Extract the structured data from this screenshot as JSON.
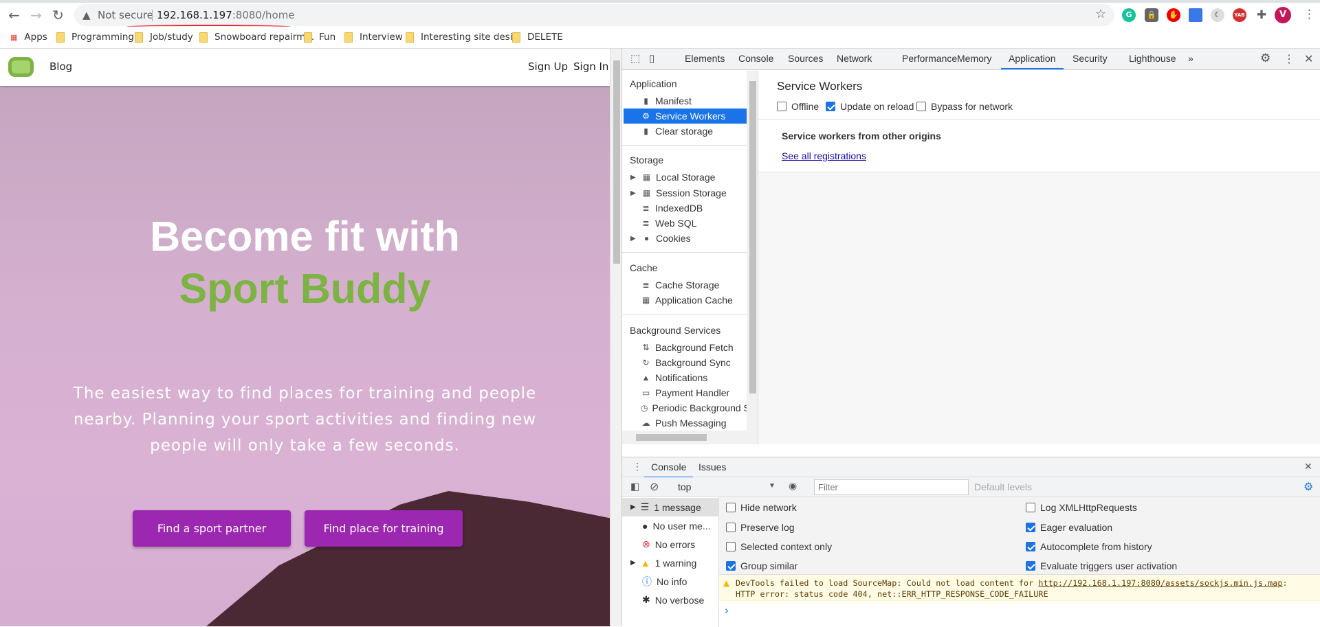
{
  "browser": {
    "security_label": "Not secure",
    "url_host": "192.168.1.197",
    "url_rest": ":8080/home",
    "profile_initial": "V",
    "extensions": [
      "grammarly",
      "lock",
      "adblock",
      "calendar",
      "dark-mode",
      "yab",
      "extensions-puzzle"
    ]
  },
  "bookmarks": [
    "Apps",
    "Programming",
    "Job/study",
    "Snowboard repairm...",
    "Fun",
    "Interview",
    "Interesting site desi...",
    "DELETE"
  ],
  "site": {
    "nav_blog": "Blog",
    "sign_up": "Sign Up",
    "sign_in": "Sign In",
    "headline_1": "Become fit with",
    "headline_2": "Sport Buddy",
    "subtitle": "The easiest way to find places for training and people nearby. Planning your sport activities and finding new people will only take a few seconds.",
    "btn_partner": "Find a sport partner",
    "btn_place": "Find place for training",
    "accent": "#7cb342",
    "button_color": "#9c27b0"
  },
  "devtools": {
    "tabs": [
      "Elements",
      "Console",
      "Sources",
      "Network",
      "Performance",
      "Memory",
      "Application",
      "Security",
      "Lighthouse"
    ],
    "active_tab": "Application",
    "sidebar": {
      "application": {
        "title": "Application",
        "items": [
          "Manifest",
          "Service Workers",
          "Clear storage"
        ]
      },
      "storage": {
        "title": "Storage",
        "items": [
          "Local Storage",
          "Session Storage",
          "IndexedDB",
          "Web SQL",
          "Cookies"
        ]
      },
      "cache": {
        "title": "Cache",
        "items": [
          "Cache Storage",
          "Application Cache"
        ]
      },
      "background": {
        "title": "Background Services",
        "items": [
          "Background Fetch",
          "Background Sync",
          "Notifications",
          "Payment Handler",
          "Periodic Background Sync",
          "Push Messaging"
        ]
      }
    },
    "panel": {
      "title": "Service Workers",
      "offline": "Offline",
      "update_on_reload": "Update on reload",
      "bypass": "Bypass for network",
      "other_origins": "Service workers from other origins",
      "see_all": "See all registrations"
    },
    "drawer": {
      "tabs": [
        "Console",
        "Issues"
      ],
      "context": "top",
      "filter_placeholder": "Filter",
      "levels": "Default levels",
      "sidebar": [
        "1 message",
        "No user me...",
        "No errors",
        "1 warning",
        "No info",
        "No verbose"
      ],
      "settings_left": [
        "Hide network",
        "Preserve log",
        "Selected context only",
        "Group similar"
      ],
      "settings_right": [
        "Log XMLHttpRequests",
        "Eager evaluation",
        "Autocomplete from history",
        "Evaluate triggers user activation"
      ],
      "warning_prefix": "DevTools failed to load SourceMap: Could not load content for ",
      "warning_link": "http://192.168.1.197:8080/assets/sockjs.min.js.map",
      "warning_suffix": ":",
      "warning_line2": "HTTP error: status code 404, net::ERR_HTTP_RESPONSE_CODE_FAILURE",
      "prompt": "›"
    }
  }
}
